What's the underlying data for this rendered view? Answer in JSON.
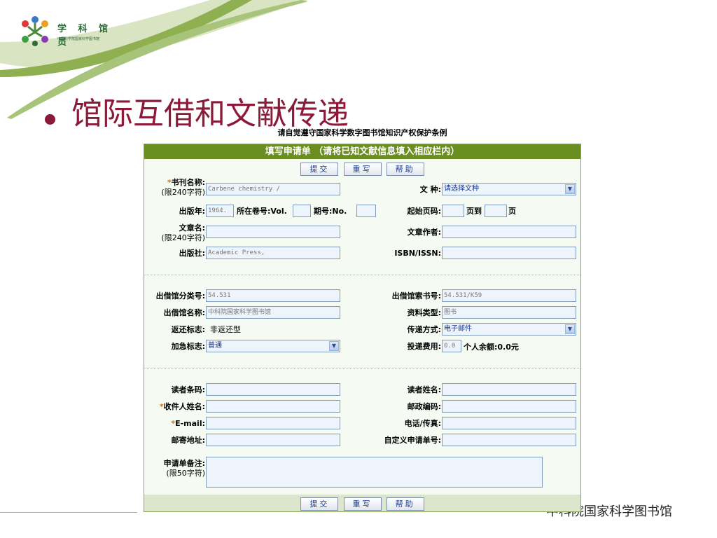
{
  "slide": {
    "logo_name": "学 科 馆 员",
    "logo_sub": "中国科学院国家科学图书馆",
    "title": "馆际互借和文献传递",
    "footer": "中科院国家科学图书馆"
  },
  "notice": "请自觉遵守国家科学数字图书馆知识产权保护条例",
  "form": {
    "header": "填写申请单 （请将已知文献信息填入相应栏内）",
    "buttons": {
      "submit": "提交",
      "rewrite": "重写",
      "help": "帮助"
    },
    "journal_title": {
      "label": "书刊名称:",
      "sub": "(限240字符)",
      "value": "Carbene chemistry /"
    },
    "doc_type": {
      "label": "文 种:",
      "value": "请选择文种"
    },
    "pub_year": {
      "label": "出版年:",
      "value": "1964."
    },
    "volume": {
      "label": "所在卷号:Vol.",
      "value": ""
    },
    "issue": {
      "label": "期号:No.",
      "value": ""
    },
    "start_page": {
      "label": "起始页码:",
      "to": "页到",
      "end": "页"
    },
    "article_title": {
      "label": "文章名:",
      "sub": "(限240字符)",
      "value": ""
    },
    "article_author": {
      "label": "文章作者:",
      "value": ""
    },
    "publisher": {
      "label": "出版社:",
      "value": "Academic Press,"
    },
    "isbn": {
      "label": "ISBN/ISSN:",
      "value": ""
    },
    "lending_class": {
      "label": "出借馆分类号:",
      "value": "54.531"
    },
    "lending_call": {
      "label": "出借馆索书号:",
      "value": "54.531/K59"
    },
    "lending_lib": {
      "label": "出借馆名称:",
      "value": "中科院国家科学图书馆"
    },
    "material_type": {
      "label": "资料类型:",
      "value": "图书"
    },
    "return_flag": {
      "label": "返还标志:",
      "value": "非返还型"
    },
    "delivery": {
      "label": "传递方式:",
      "value": "电子邮件"
    },
    "urgency": {
      "label": "加急标志:",
      "value": "普通"
    },
    "fee": {
      "label": "投递费用:",
      "value": "0.0",
      "balance": "个人余额:0.0元"
    },
    "reader_barcode": {
      "label": "读者条码:",
      "value": ""
    },
    "reader_name": {
      "label": "读者姓名:",
      "value": ""
    },
    "recipient": {
      "label": "收件人姓名:",
      "value": ""
    },
    "postcode": {
      "label": "邮政编码:",
      "value": ""
    },
    "email": {
      "label": "E-mail:",
      "value": ""
    },
    "phone": {
      "label": "电话/传真:",
      "value": ""
    },
    "address": {
      "label": "邮寄地址:",
      "value": ""
    },
    "custom_no": {
      "label": "自定义申请单号:",
      "value": ""
    },
    "remarks": {
      "label": "申请单备注:",
      "sub": "(限50字符)"
    }
  },
  "colors": {
    "title": "#8b1a3a",
    "header": "#6b8e23",
    "required": "#e07000",
    "input_bg": "#eef4fc"
  }
}
